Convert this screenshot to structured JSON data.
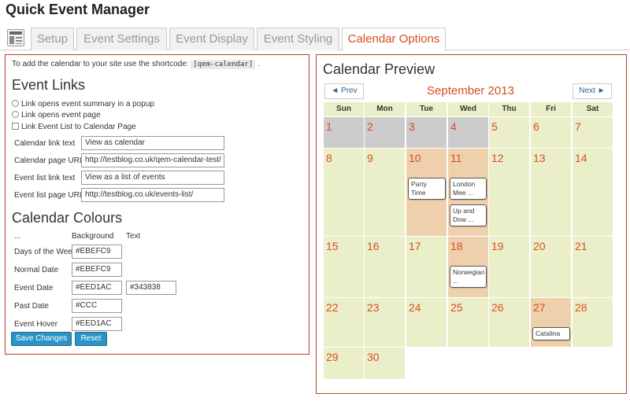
{
  "app": {
    "title": "Quick Event Manager"
  },
  "tabs": [
    "Setup",
    "Event Settings",
    "Event Display",
    "Event Styling",
    "Calendar Options"
  ],
  "left": {
    "shortcode_prefix": "To add the calendar to your site use the shortcode:",
    "shortcode": "[qem-calendar]",
    "shortcode_suffix": ".",
    "event_links": {
      "heading": "Event Links",
      "options": [
        "Link opens event summary in a popup",
        "Link opens event page"
      ],
      "checkbox_label": "Link Event List to Calendar Page",
      "fields": [
        {
          "label": "Calendar link text",
          "value": "View as calendar"
        },
        {
          "label": "Calendar page URL",
          "value": "http://testblog.co.uk/qem-calendar-test/"
        },
        {
          "label": "Event list link text",
          "value": "View as a list of events"
        },
        {
          "label": "Event list page URL",
          "value": "http://testblog.co.uk/events-list/"
        }
      ]
    },
    "colours": {
      "heading": "Calendar Colours",
      "col_dots": "...",
      "col_bg": "Background",
      "col_text": "Text",
      "rows": [
        {
          "label": "Days of the Week",
          "bg": "#EBEFC9"
        },
        {
          "label": "Normal Date",
          "bg": "#EBEFC9"
        },
        {
          "label": "Event Date",
          "bg": "#EED1AC",
          "text": "#343838"
        },
        {
          "label": "Past Date",
          "bg": "#CCC"
        },
        {
          "label": "Event Hover",
          "bg": "#EED1AC"
        }
      ]
    },
    "buttons": {
      "save": "Save Changes",
      "reset": "Reset"
    }
  },
  "calendar": {
    "title": "Calendar Preview",
    "prev": "◄ Prev",
    "next": "Next ►",
    "month": "September 2013",
    "days_of_week": [
      "Sun",
      "Mon",
      "Tue",
      "Wed",
      "Thu",
      "Fri",
      "Sat"
    ],
    "weeks": [
      [
        {
          "d": "1",
          "s": "past"
        },
        {
          "d": "2",
          "s": "past"
        },
        {
          "d": "3",
          "s": "past"
        },
        {
          "d": "4",
          "s": "past"
        },
        {
          "d": "5",
          "s": "normal"
        },
        {
          "d": "6",
          "s": "normal"
        },
        {
          "d": "7",
          "s": "normal"
        }
      ],
      [
        {
          "d": "8",
          "s": "normal"
        },
        {
          "d": "9",
          "s": "normal"
        },
        {
          "d": "10",
          "s": "event",
          "events": [
            "Party Time"
          ]
        },
        {
          "d": "11",
          "s": "event",
          "events": [
            "London Mee ...",
            "Up and Dow ..."
          ]
        },
        {
          "d": "12",
          "s": "normal"
        },
        {
          "d": "13",
          "s": "normal"
        },
        {
          "d": "14",
          "s": "normal"
        }
      ],
      [
        {
          "d": "15",
          "s": "normal"
        },
        {
          "d": "16",
          "s": "normal"
        },
        {
          "d": "17",
          "s": "normal"
        },
        {
          "d": "18",
          "s": "event",
          "events": [
            "Norwegian ..."
          ]
        },
        {
          "d": "19",
          "s": "normal"
        },
        {
          "d": "20",
          "s": "normal"
        },
        {
          "d": "21",
          "s": "normal"
        }
      ],
      [
        {
          "d": "22",
          "s": "normal"
        },
        {
          "d": "23",
          "s": "normal"
        },
        {
          "d": "24",
          "s": "normal"
        },
        {
          "d": "25",
          "s": "normal"
        },
        {
          "d": "26",
          "s": "normal"
        },
        {
          "d": "27",
          "s": "event",
          "events": [
            "Catalina"
          ]
        },
        {
          "d": "28",
          "s": "normal"
        }
      ],
      [
        {
          "d": "29",
          "s": "normal"
        },
        {
          "d": "30",
          "s": "normal"
        }
      ]
    ]
  },
  "colors": {
    "accent": "#d54e21",
    "border": "#c0392b",
    "button": "#2a95c5"
  },
  "icons": {
    "tab_logo": "calendar-layout-icon"
  }
}
